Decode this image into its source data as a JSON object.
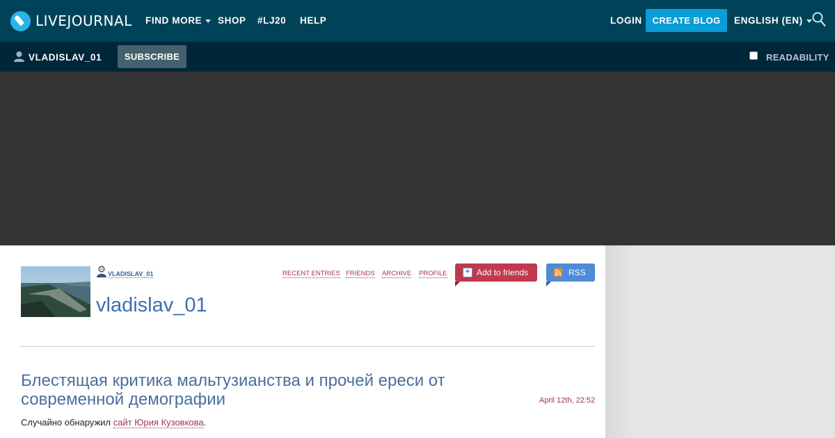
{
  "header": {
    "logo_text": "LIVEJOURNAL",
    "nav": {
      "find_more": "FIND MORE",
      "shop": "SHOP",
      "lj20": "#LJ20",
      "help": "HELP"
    },
    "login": "LOGIN",
    "create_blog": "CREATE BLOG",
    "language": "ENGLISH (EN)"
  },
  "subbar": {
    "username": "VLADISLAV_01",
    "subscribe": "SUBSCRIBE",
    "readability": "READABILITY",
    "readability_checked": false
  },
  "journal": {
    "small_username": "VLADISLAV_01",
    "title": "vladislav_01",
    "nav": {
      "recent_entries": "RECENT ENTRIES",
      "friends": "FRIENDS",
      "archive": "ARCHIVE",
      "profile": "PROFILE"
    },
    "add_to_friends": "Add to friends",
    "rss": "RSS"
  },
  "post": {
    "title": "Блестящая критика мальтузианства и прочей ереси от современной демографии",
    "date": "April 12th, 22:52",
    "body_prefix": "Случайно обнаружил ",
    "body_link": "сайт Юрия Кузовкова",
    "body_suffix": "."
  },
  "colors": {
    "topbar": "#004359",
    "subbar": "#00263a",
    "accent": "#0a9dd6",
    "link": "#a0335a",
    "title": "#3d6fb0"
  }
}
